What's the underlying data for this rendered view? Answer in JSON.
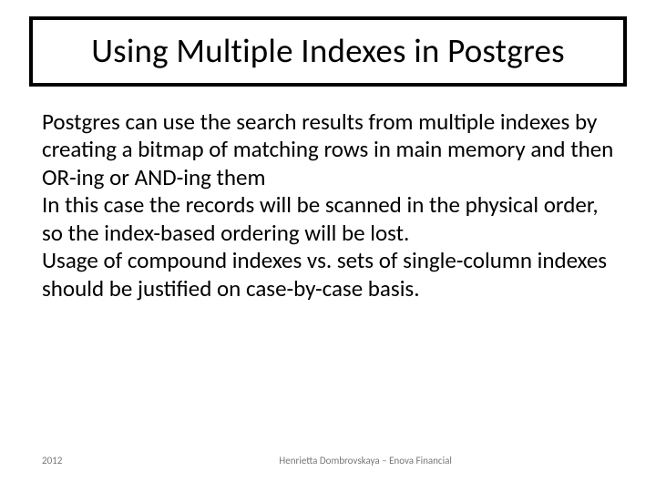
{
  "title": "Using Multiple Indexes in Postgres",
  "body": {
    "p1": "Postgres can use the search results from multiple indexes by creating a bitmap of matching rows in main memory and then OR-ing or AND-ing them",
    "p2": "In this case the records will be scanned in the physical order, so the index-based ordering will be lost.",
    "p3": "Usage of compound indexes vs. sets of single-column indexes should be justified on case-by-case basis."
  },
  "footer": {
    "year": "2012",
    "author": "Henrietta Dombrovskaya – Enova Financial"
  }
}
